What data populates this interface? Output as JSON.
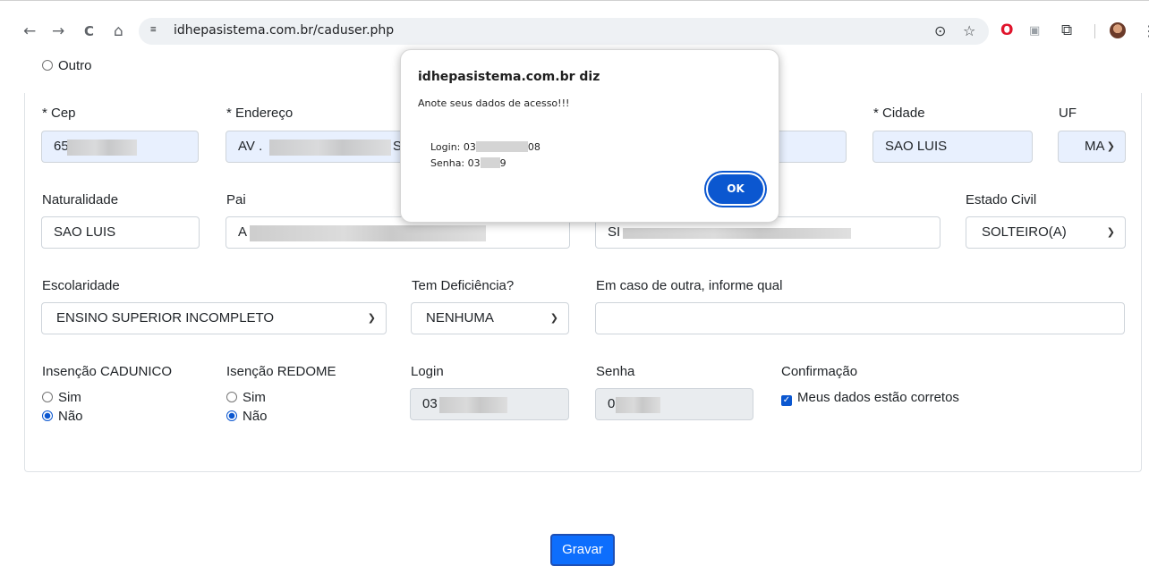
{
  "browser": {
    "back_icon": "←",
    "forward_icon": "→",
    "reload_icon": "C",
    "home_icon": "⌂",
    "site_settings_icon": "≡",
    "url": "idhepasistema.com.br/caduser.php",
    "location_icon": "⊙",
    "star_icon": "☆",
    "opera_icon": "O",
    "ext_icon": "▣",
    "puzzle_icon": "⧉",
    "menu_icon": "⋮"
  },
  "form": {
    "outro_label": "Outro",
    "cep_label": "* Cep",
    "cep_value": "65",
    "endereco_label": "* Endereço",
    "endereco_value_start": "AV .",
    "endereco_value_end": "S",
    "cidade_label": "* Cidade",
    "cidade_value": "SAO LUIS",
    "uf_label": "UF",
    "uf_value": "MA",
    "naturalidade_label": "Naturalidade",
    "naturalidade_value": "SAO LUIS",
    "pai_label": "Pai",
    "pai_value": "A",
    "mae_value": "SI",
    "estado_civil_label": "Estado Civil",
    "estado_civil_value": "SOLTEIRO(A)",
    "escolaridade_label": "Escolaridade",
    "escolaridade_value": "ENSINO SUPERIOR INCOMPLETO",
    "deficiencia_label": "Tem Deficiência?",
    "deficiencia_value": "NENHUMA",
    "outra_label": "Em caso de outra, informe qual",
    "outra_value": "",
    "cadunico_label": "Insenção CADUNICO",
    "redome_label": "Isenção REDOME",
    "sim_label": "Sim",
    "nao_label": "Não",
    "login_label": "Login",
    "login_value": "03",
    "senha_label": "Senha",
    "senha_value": "0",
    "confirmacao_label": "Confirmação",
    "confirm_check_label": "Meus dados estão corretos",
    "save_label": "Gravar"
  },
  "dialog": {
    "title": "idhepasistema.com.br diz",
    "message": "Anote seus dados de acesso!!!",
    "login_line_start": "Login: 03",
    "login_line_end": "08",
    "senha_line_start": "Senha: 03",
    "senha_line_end": "9",
    "ok_label": "OK"
  }
}
